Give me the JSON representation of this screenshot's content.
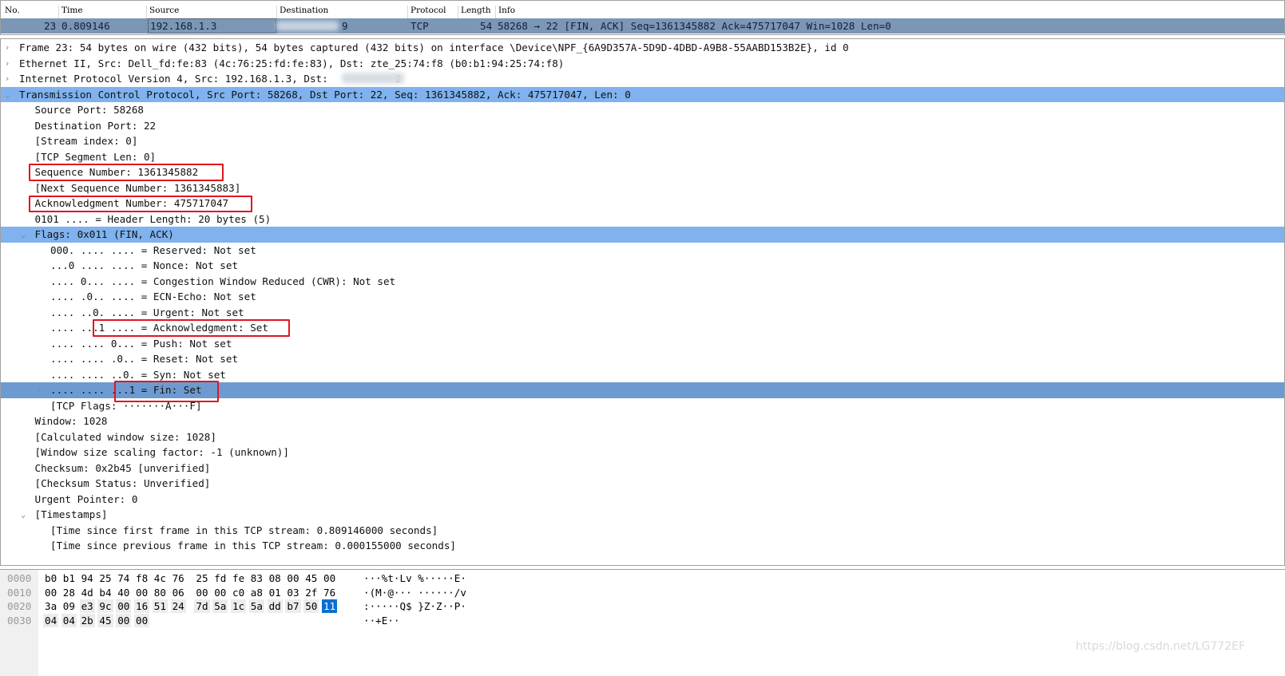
{
  "packet_list": {
    "columns": [
      "No.",
      "Time",
      "Source",
      "Destination",
      "Protocol",
      "Length",
      "Info"
    ],
    "selected_row": {
      "no": "23",
      "time": "0.809146",
      "source": "192.168.1.3",
      "destination_visible": "9",
      "protocol": "TCP",
      "length": "54",
      "info": "58268 → 22 [FIN, ACK] Seq=1361345882 Ack=475717047 Win=1028 Len=0"
    }
  },
  "tree": [
    {
      "level": 0,
      "exp": "collapsed",
      "text": "Frame 23: 54 bytes on wire (432 bits), 54 bytes captured (432 bits) on interface \\Device\\NPF_{6A9D357A-5D9D-4DBD-A9B8-55AABD153B2E}, id 0"
    },
    {
      "level": 0,
      "exp": "collapsed",
      "text": "Ethernet II, Src: Dell_fd:fe:83 (4c:76:25:fd:fe:83), Dst: zte_25:74:f8 (b0:b1:94:25:74:f8)"
    },
    {
      "level": 0,
      "exp": "collapsed",
      "text": "Internet Protocol Version 4, Src: 192.168.1.3, Dst:           9"
    },
    {
      "level": 0,
      "exp": "expanded",
      "sel": "sel",
      "text": "Transmission Control Protocol, Src Port: 58268, Dst Port: 22, Seq: 1361345882, Ack: 475717047, Len: 0"
    },
    {
      "level": 1,
      "text": "Source Port: 58268"
    },
    {
      "level": 1,
      "text": "Destination Port: 22"
    },
    {
      "level": 1,
      "text": "[Stream index: 0]"
    },
    {
      "level": 1,
      "text": "[TCP Segment Len: 0]"
    },
    {
      "level": 1,
      "text": "Sequence Number: 1361345882"
    },
    {
      "level": 1,
      "text": "[Next Sequence Number: 1361345883]"
    },
    {
      "level": 1,
      "text": "Acknowledgment Number: 475717047"
    },
    {
      "level": 1,
      "text": "0101 .... = Header Length: 20 bytes (5)"
    },
    {
      "level": 1,
      "exp": "expanded",
      "sel": "sel",
      "text": "Flags: 0x011 (FIN, ACK)"
    },
    {
      "level": 2,
      "text": "000. .... .... = Reserved: Not set"
    },
    {
      "level": 2,
      "text": "...0 .... .... = Nonce: Not set"
    },
    {
      "level": 2,
      "text": ".... 0... .... = Congestion Window Reduced (CWR): Not set"
    },
    {
      "level": 2,
      "text": ".... .0.. .... = ECN-Echo: Not set"
    },
    {
      "level": 2,
      "text": ".... ..0. .... = Urgent: Not set"
    },
    {
      "level": 2,
      "text": ".... ...1 .... = Acknowledgment: Set"
    },
    {
      "level": 2,
      "text": ".... .... 0... = Push: Not set"
    },
    {
      "level": 2,
      "text": ".... .... .0.. = Reset: Not set"
    },
    {
      "level": 2,
      "text": ".... .... ..0. = Syn: Not set"
    },
    {
      "level": 2,
      "exp": "collapsed",
      "sel": "sel2",
      "text": ".... .... ...1 = Fin: Set"
    },
    {
      "level": 2,
      "text": "[TCP Flags: ·······A···F]"
    },
    {
      "level": 1,
      "text": "Window: 1028"
    },
    {
      "level": 1,
      "text": "[Calculated window size: 1028]"
    },
    {
      "level": 1,
      "text": "[Window size scaling factor: -1 (unknown)]"
    },
    {
      "level": 1,
      "text": "Checksum: 0x2b45 [unverified]"
    },
    {
      "level": 1,
      "text": "[Checksum Status: Unverified]"
    },
    {
      "level": 1,
      "text": "Urgent Pointer: 0"
    },
    {
      "level": 1,
      "exp": "expanded",
      "text": "[Timestamps]"
    },
    {
      "level": 2,
      "text": "[Time since first frame in this TCP stream: 0.809146000 seconds]"
    },
    {
      "level": 2,
      "text": "[Time since previous frame in this TCP stream: 0.000155000 seconds]"
    }
  ],
  "hex": [
    {
      "offset": "0000",
      "bytes": [
        "b0",
        "b1",
        "94",
        "25",
        "74",
        "f8",
        "4c",
        "76",
        "25",
        "fd",
        "fe",
        "83",
        "08",
        "00",
        "45",
        "00"
      ],
      "ascii": "···%t·Lv %·····E·"
    },
    {
      "offset": "0010",
      "bytes": [
        "00",
        "28",
        "4d",
        "b4",
        "40",
        "00",
        "80",
        "06",
        "00",
        "00",
        "c0",
        "a8",
        "01",
        "03",
        "2f",
        "76"
      ],
      "ascii": "·(M·@··· ······/v"
    },
    {
      "offset": "0020",
      "bytes": [
        "3a",
        "09",
        "e3",
        "9c",
        "00",
        "16",
        "51",
        "24",
        "7d",
        "5a",
        "1c",
        "5a",
        "dd",
        "b7",
        "50",
        "11"
      ],
      "ascii": ":·····Q$ }Z·Z··P·"
    },
    {
      "offset": "0030",
      "bytes": [
        "04",
        "04",
        "2b",
        "45",
        "00",
        "00"
      ],
      "ascii": "··+E··"
    }
  ],
  "watermark": "https://blog.csdn.net/LG772EF",
  "colors": {
    "selected_row": "#7fb2ee",
    "selected_field": "#6d9bd1",
    "packet_row": "#7c97b6",
    "annotation_box": "#e0161e",
    "selected_byte": "#0a6fd0"
  }
}
